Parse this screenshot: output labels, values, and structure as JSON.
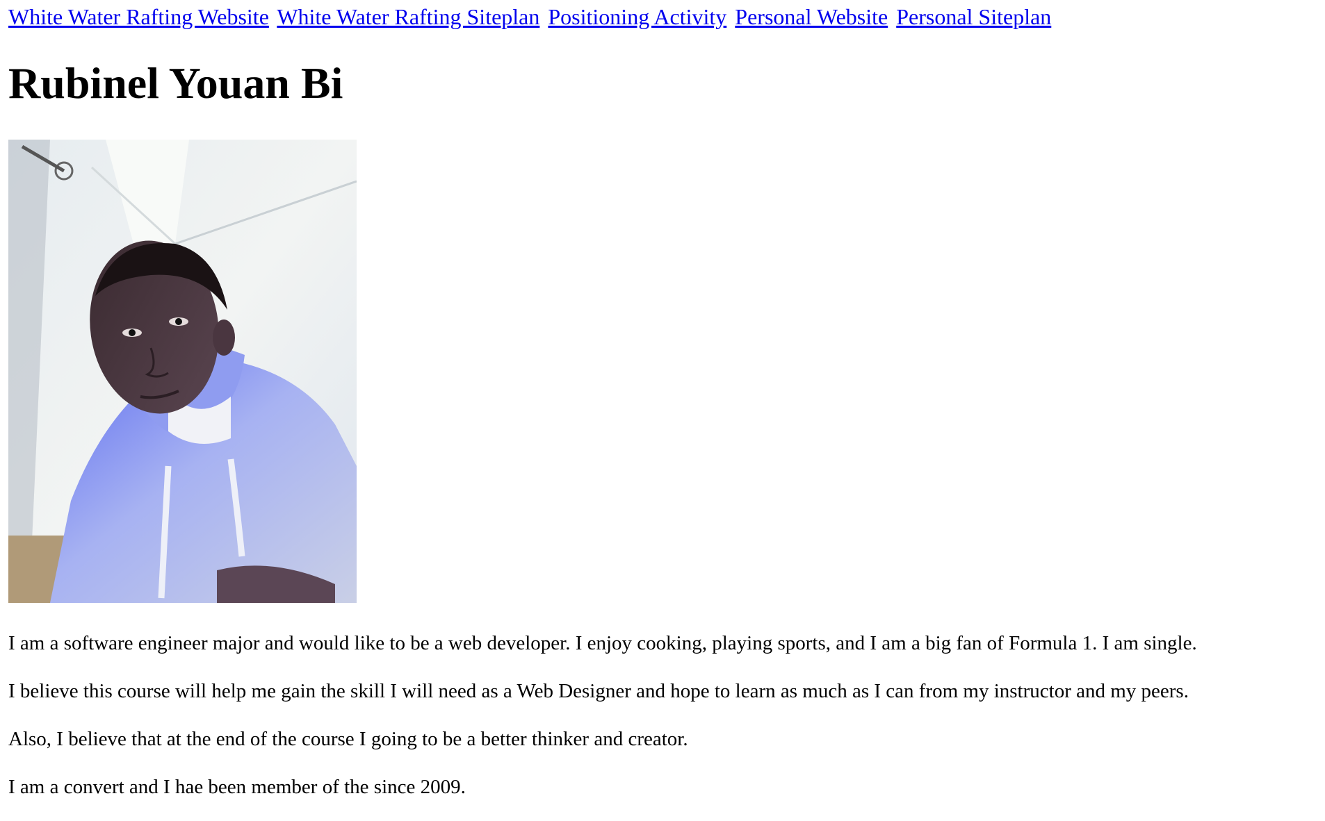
{
  "nav": {
    "links": [
      {
        "label": "White Water Rafting Website"
      },
      {
        "label": "White Water Rafting Siteplan"
      },
      {
        "label": "Positioning Activity"
      },
      {
        "label": "Personal Website"
      },
      {
        "label": "Personal Siteplan"
      }
    ]
  },
  "page": {
    "title": "Rubinel Youan Bi"
  },
  "colors": {
    "link": "#0000ee",
    "text": "#000000",
    "background": "#ffffff"
  },
  "paragraphs": [
    "I am a software engineer major and would like to be a web developer. I enjoy cooking, playing sports, and I am a big fan of Formula 1. I am single.",
    "I believe this course will help me gain the skill I will need as a Web Designer and hope to learn as much as I can from my instructor and my peers.",
    "Also, I believe that at the end of the course I going to be a better thinker and creator.",
    "I am a convert and I hae been member of the since 2009."
  ]
}
